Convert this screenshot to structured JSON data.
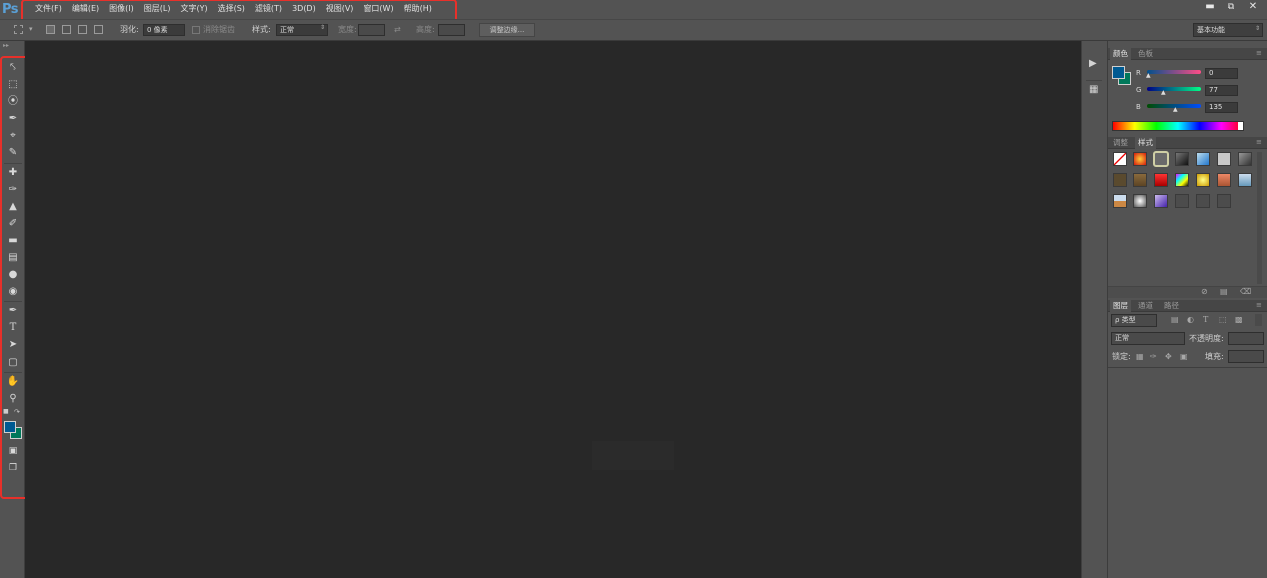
{
  "app_logo": "Ps",
  "menu": [
    "文件(F)",
    "编辑(E)",
    "图像(I)",
    "图层(L)",
    "文字(Y)",
    "选择(S)",
    "滤镜(T)",
    "3D(D)",
    "视图(V)",
    "窗口(W)",
    "帮助(H)"
  ],
  "window_controls": [
    "minimize-icon",
    "restore-icon",
    "close-icon"
  ],
  "options_bar": {
    "feather_label": "羽化:",
    "feather_value": "0 像素",
    "antialias_label": "消除锯齿",
    "style_label": "样式:",
    "style_value": "正常",
    "width_label": "宽度:",
    "height_label": "高度:",
    "refine_edge_button": "调整边缘...",
    "workspace_value": "基本功能"
  },
  "color_panel": {
    "tabs": [
      "颜色",
      "色板"
    ],
    "active_tab": "颜色",
    "foreground_color": "#005A92",
    "background_color": "#004D87",
    "channels": [
      {
        "label": "R",
        "value": "0"
      },
      {
        "label": "G",
        "value": "77"
      },
      {
        "label": "B",
        "value": "135"
      }
    ]
  },
  "styles_panel": {
    "tabs": [
      "调整",
      "样式"
    ],
    "active_tab": "样式"
  },
  "layers_panel": {
    "tabs": [
      "图层",
      "通道",
      "路径"
    ],
    "active_tab": "图层",
    "filter_kind": "ρ 类型",
    "blend_mode": "正常",
    "opacity_label": "不透明度:",
    "lock_label": "锁定:",
    "fill_label": "填充:"
  },
  "highlight_color": "#E8302A"
}
